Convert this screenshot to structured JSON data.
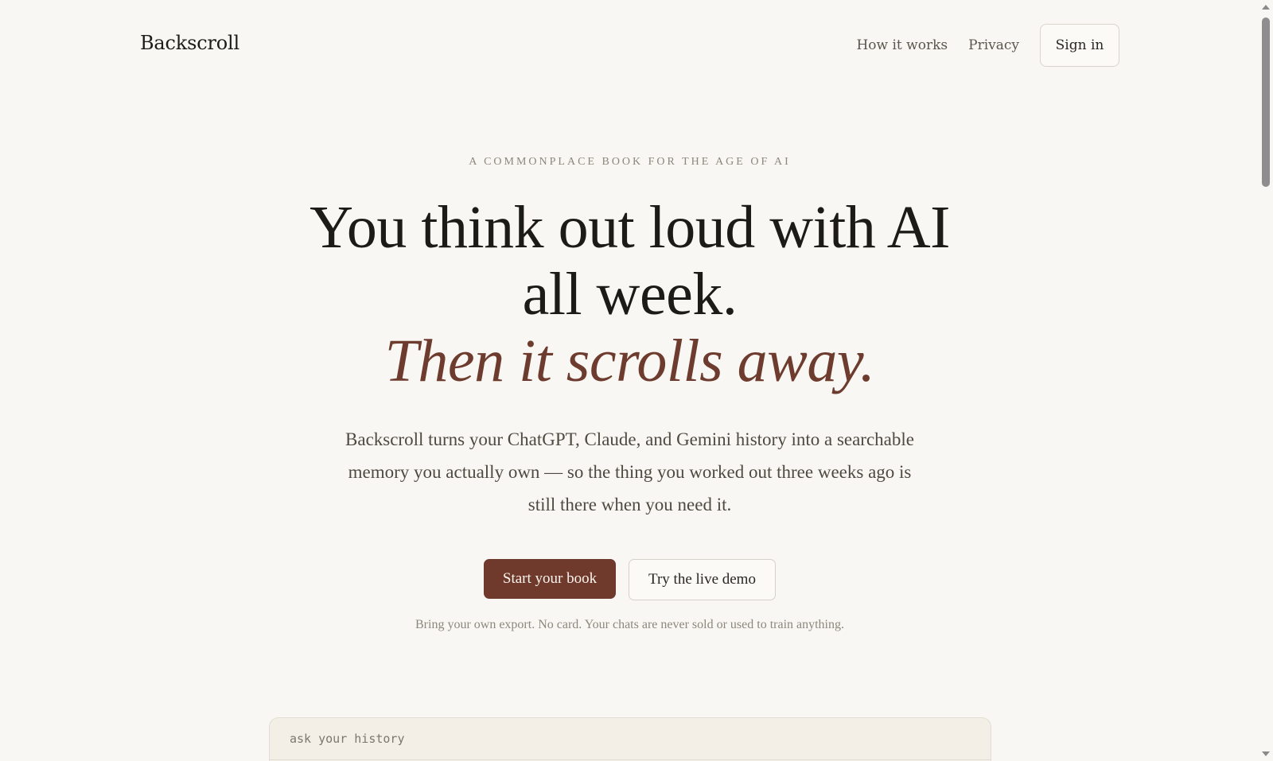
{
  "header": {
    "brand": "Backscroll",
    "nav": {
      "how_it_works": "How it works",
      "privacy": "Privacy",
      "sign_in": "Sign in"
    }
  },
  "hero": {
    "eyebrow": "A COMMONPLACE BOOK FOR THE AGE OF AI",
    "headline_line1": "You think out loud with AI",
    "headline_line2": "all week.",
    "headline_accent": "Then it scrolls away.",
    "subcopy": "Backscroll turns your ChatGPT, Claude, and Gemini history into a searchable memory you actually own — so the thing you worked out three weeks ago is still there when you need it.",
    "cta_primary": "Start your book",
    "cta_secondary": "Try the live demo",
    "fineprint": "Bring your own export. No card. Your chats are never sold or used to train anything."
  },
  "history_box": {
    "label": "ask your history"
  },
  "colors": {
    "background": "#f9f7f3",
    "accent": "#6f3a2c",
    "text": "#1d1b18"
  }
}
